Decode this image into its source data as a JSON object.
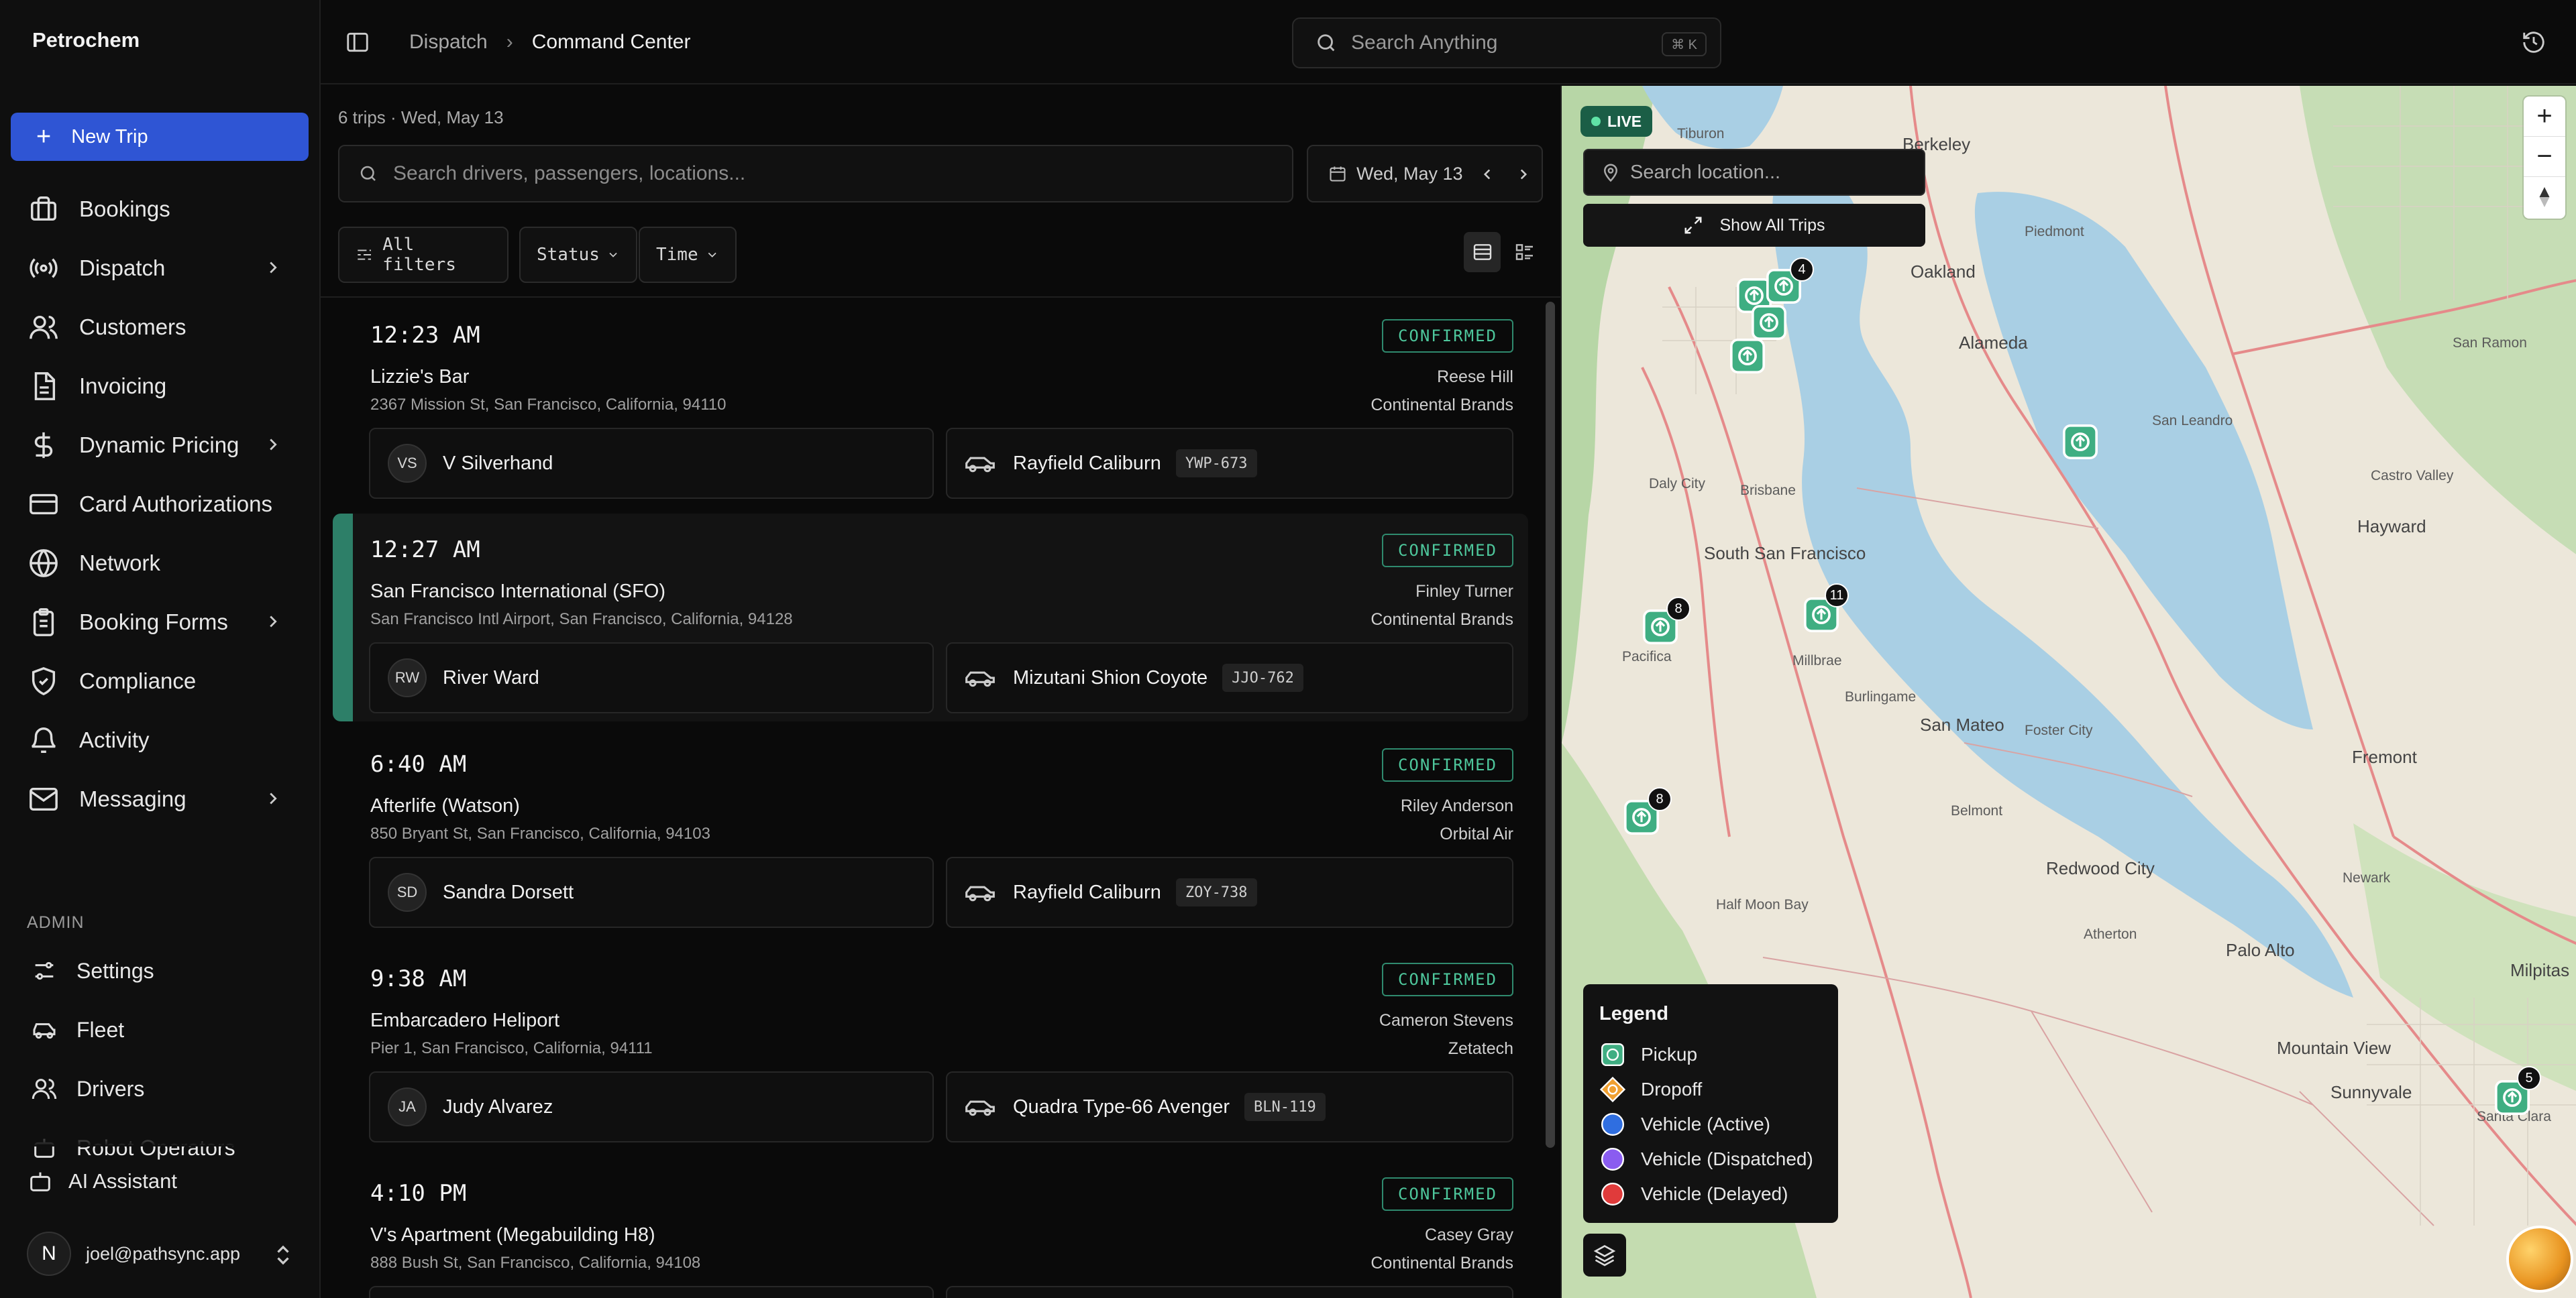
{
  "app": {
    "brand": "Petrochem"
  },
  "sidebar": {
    "new_trip": "New Trip",
    "items": [
      {
        "label": "Bookings",
        "icon": "briefcase-icon"
      },
      {
        "label": "Dispatch",
        "icon": "broadcast-icon"
      },
      {
        "label": "Customers",
        "icon": "users-icon"
      },
      {
        "label": "Invoicing",
        "icon": "document-icon"
      },
      {
        "label": "Dynamic Pricing",
        "icon": "dollar-icon"
      },
      {
        "label": "Card Authorizations",
        "icon": "credit-card-icon"
      },
      {
        "label": "Network",
        "icon": "globe-icon"
      },
      {
        "label": "Booking Forms",
        "icon": "clipboard-icon"
      },
      {
        "label": "Compliance",
        "icon": "shield-icon"
      },
      {
        "label": "Activity",
        "icon": "bell-icon"
      },
      {
        "label": "Messaging",
        "icon": "mail-icon"
      }
    ],
    "admin_label": "ADMIN",
    "admin_items": [
      {
        "label": "Settings",
        "icon": "sliders-icon"
      },
      {
        "label": "Fleet",
        "icon": "car-icon"
      },
      {
        "label": "Drivers",
        "icon": "users-icon"
      },
      {
        "label": "Robot Operators",
        "icon": "robot-icon"
      }
    ],
    "ai_assistant": "AI Assistant",
    "user": {
      "initial": "N",
      "email": "joel@pathsync.app"
    }
  },
  "topbar": {
    "breadcrumb": [
      "Dispatch",
      "Command Center"
    ],
    "search_placeholder": "Search Anything",
    "shortcut": "⌘ K"
  },
  "list": {
    "summary": "6 trips · Wed, May 13",
    "search_placeholder": "Search drivers, passengers, locations...",
    "date": "Wed, May 13",
    "filters": {
      "all": "All filters",
      "status": "Status",
      "time": "Time"
    },
    "trips": [
      {
        "time": "12:23 AM",
        "status": "CONFIRMED",
        "location": "Lizzie's Bar",
        "address": "2367 Mission St, San Francisco, California, 94110",
        "passenger": "Reese Hill",
        "company": "Continental Brands",
        "driver_initials": "VS",
        "driver": "V Silverhand",
        "vehicle": "Rayfield Caliburn",
        "plate": "YWP-673"
      },
      {
        "time": "12:27 AM",
        "status": "CONFIRMED",
        "location": "San Francisco International (SFO)",
        "address": "San Francisco Intl Airport, San Francisco, California, 94128",
        "passenger": "Finley Turner",
        "company": "Continental Brands",
        "driver_initials": "RW",
        "driver": "River Ward",
        "vehicle": "Mizutani Shion Coyote",
        "plate": "JJO-762"
      },
      {
        "time": "6:40 AM",
        "status": "CONFIRMED",
        "location": "Afterlife (Watson)",
        "address": "850 Bryant St, San Francisco, California, 94103",
        "passenger": "Riley Anderson",
        "company": "Orbital Air",
        "driver_initials": "SD",
        "driver": "Sandra Dorsett",
        "vehicle": "Rayfield Caliburn",
        "plate": "ZOY-738"
      },
      {
        "time": "9:38 AM",
        "status": "CONFIRMED",
        "location": "Embarcadero Heliport",
        "address": "Pier 1, San Francisco, California, 94111",
        "passenger": "Cameron Stevens",
        "company": "Zetatech",
        "driver_initials": "JA",
        "driver": "Judy Alvarez",
        "vehicle": "Quadra Type-66 Avenger",
        "plate": "BLN-119"
      },
      {
        "time": "4:10 PM",
        "status": "CONFIRMED",
        "location": "V's Apartment (Megabuilding H8)",
        "address": "888 Bush St, San Francisco, California, 94108",
        "passenger": "Casey Gray",
        "company": "Continental Brands"
      }
    ]
  },
  "map": {
    "live": "LIVE",
    "search_placeholder": "Search location...",
    "show_all": "Show All Trips",
    "legend_title": "Legend",
    "legend": [
      "Pickup",
      "Dropoff",
      "Vehicle (Active)",
      "Vehicle (Dispatched)",
      "Vehicle (Delayed)"
    ],
    "colors": {
      "pickup": "#3fae82",
      "dropoff": "#f0a030",
      "active": "#2f6ee0",
      "dispatched": "#8a5cf0",
      "delayed": "#e03b3b"
    },
    "cluster_counts": [
      "4",
      "11",
      "8",
      "8",
      "5"
    ],
    "place_labels": [
      "Tiburon",
      "Berkeley",
      "Oakland",
      "Piedmont",
      "Alameda",
      "San Leandro",
      "San Ramon",
      "Castro Valley",
      "Hayward",
      "Daly City",
      "Brisbane",
      "South San Francisco",
      "Pacifica",
      "Millbrae",
      "Burlingame",
      "San Mateo",
      "Foster City",
      "Belmont",
      "Redwood City",
      "Half Moon Bay",
      "Atherton",
      "Palo Alto",
      "Fremont",
      "Newark",
      "Mountain View",
      "Sunnyvale",
      "Milpitas",
      "Santa Clara"
    ]
  }
}
